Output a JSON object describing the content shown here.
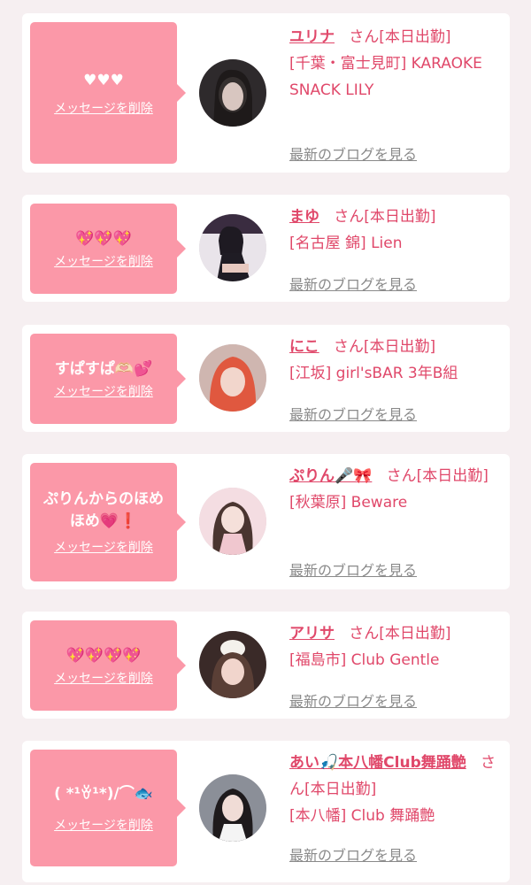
{
  "delete_label": "メッセージを削除",
  "san_label": "さん",
  "status_label": "[本日出勤]",
  "blog_label": "最新のブログを見る",
  "colors": {
    "accent": "#e0486a",
    "bubble": "#fb98a8",
    "link_gray": "#8a8a8a"
  },
  "messages": [
    {
      "message": "♥♥♥",
      "name": "ユリナ",
      "shop": "[千葉・富士見町] KARAOKE SNACK LILY"
    },
    {
      "message": "💖💖💖",
      "name": "まゆ",
      "shop": "[名古屋 錦] Lien"
    },
    {
      "message": "すぱすぱ🫶🏻💕",
      "name": "にこ",
      "shop": "[江坂] girl'sBAR 3年B組"
    },
    {
      "message": "ぷりんからのほめほめ💗❗️",
      "name": "ぷりん🎤🎀",
      "shop": "[秋葉原] Beware"
    },
    {
      "message": "💖💖💖💖",
      "name": "アリサ",
      "shop": "[福島市] Club Gentle"
    },
    {
      "message": "( *¹ꈊ¹*)/⌒🐟",
      "name": "あい🎣本八幡Club舞踊艶",
      "shop": "[本八幡] Club 舞踊艶"
    }
  ]
}
